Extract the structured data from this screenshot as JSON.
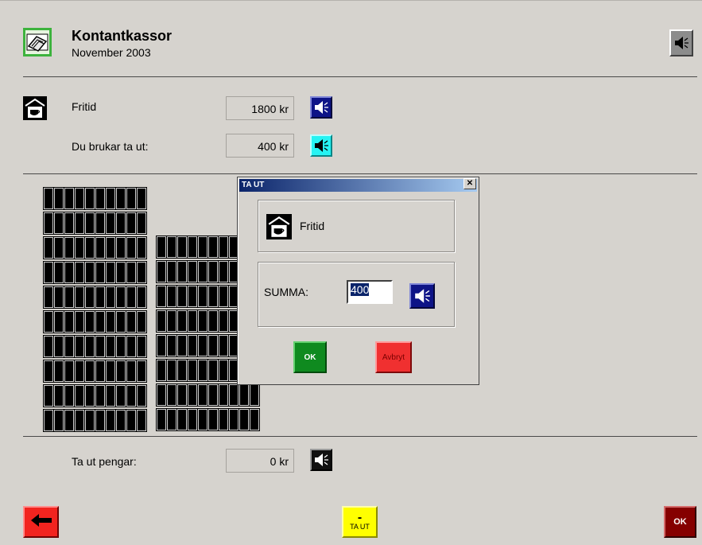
{
  "header": {
    "title": "Kontantkassor",
    "subtitle": "November 2003",
    "app_icon": "wallet-icon",
    "speaker_icon": "speaker-icon"
  },
  "category": {
    "icon": "coffee-cup-icon",
    "name": "Fritid",
    "amount": "1800 kr",
    "spend_label": "Du brukar ta ut:",
    "spend_amount": "400 kr"
  },
  "withdraw": {
    "label": "Ta ut pengar:",
    "amount": "0 kr"
  },
  "dialog": {
    "title": "TA UT",
    "close": "✕",
    "category_name": "Fritid",
    "summa_label": "SUMMA:",
    "summa_value": "400",
    "ok_label": "OK",
    "cancel_label": "Avbryt"
  },
  "footer": {
    "back_icon": "left-arrow-icon",
    "withdraw_symbol": "-",
    "withdraw_label": "TA UT",
    "ok_label": "OK"
  },
  "colors": {
    "background": "#d6d3ce",
    "speaker_navy": "#0e1487",
    "speaker_cyan": "#26f3f3",
    "ok_green": "#0f8a1f",
    "cancel_red": "#f03030",
    "footer_ok": "#850000",
    "withdraw_yellow": "#ffff00"
  }
}
